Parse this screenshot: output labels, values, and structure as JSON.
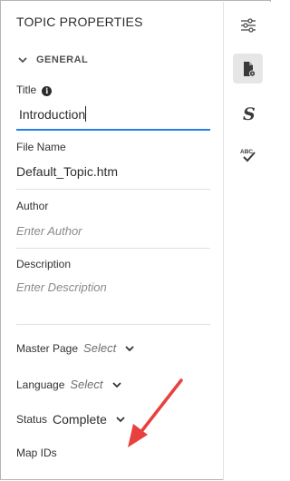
{
  "panel": {
    "title": "TOPIC PROPERTIES",
    "section_general": "GENERAL"
  },
  "fields": {
    "title_label": "Title",
    "title_value": "Introduction",
    "filename_label": "File Name",
    "filename_value": "Default_Topic.htm",
    "author_label": "Author",
    "author_placeholder": "Enter Author",
    "description_label": "Description",
    "description_placeholder": "Enter Description",
    "master_page_label": "Master Page",
    "master_page_value": "Select",
    "language_label": "Language",
    "language_value": "Select",
    "status_label": "Status",
    "status_value": "Complete",
    "map_ids_label": "Map IDs"
  },
  "rail": {
    "icons": [
      "sliders-icon",
      "topic-properties-icon",
      "style-icon",
      "spell-check-icon"
    ],
    "active": "topic-properties-icon",
    "spell_text": "ABC"
  },
  "colors": {
    "accent_underline": "#2680eb",
    "annotation_arrow": "#e8403e",
    "active_rail_bg": "#e6e6e6"
  }
}
